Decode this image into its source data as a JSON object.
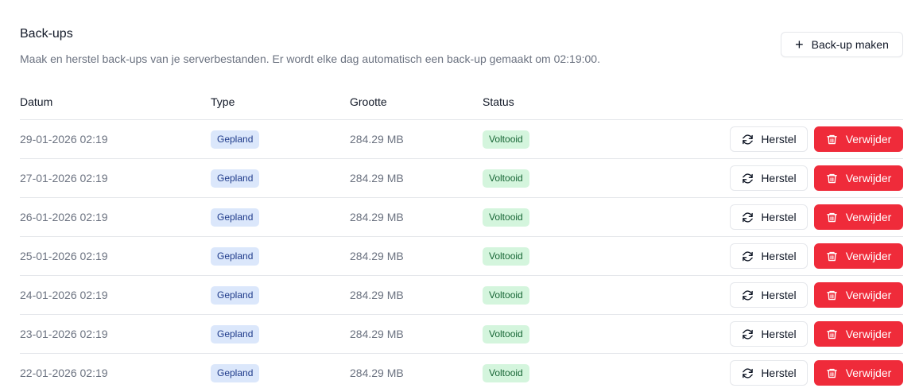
{
  "header": {
    "title": "Back-ups",
    "subtitle": "Maak en herstel back-ups van je serverbestanden. Er wordt elke dag automatisch een back-up gemaakt om 02:19:00."
  },
  "make_backup": {
    "label": "Back-up maken",
    "icon": "plus-icon"
  },
  "table": {
    "columns": [
      "Datum",
      "Type",
      "Grootte",
      "Status"
    ],
    "rows": [
      {
        "date": "29-01-2026 02:19",
        "type": "Gepland",
        "size": "284.29 MB",
        "status": "Voltooid"
      },
      {
        "date": "27-01-2026 02:19",
        "type": "Gepland",
        "size": "284.29 MB",
        "status": "Voltooid"
      },
      {
        "date": "26-01-2026 02:19",
        "type": "Gepland",
        "size": "284.29 MB",
        "status": "Voltooid"
      },
      {
        "date": "25-01-2026 02:19",
        "type": "Gepland",
        "size": "284.29 MB",
        "status": "Voltooid"
      },
      {
        "date": "24-01-2026 02:19",
        "type": "Gepland",
        "size": "284.29 MB",
        "status": "Voltooid"
      },
      {
        "date": "23-01-2026 02:19",
        "type": "Gepland",
        "size": "284.29 MB",
        "status": "Voltooid"
      },
      {
        "date": "22-01-2026 02:19",
        "type": "Gepland",
        "size": "284.29 MB",
        "status": "Voltooid"
      }
    ]
  },
  "actions": {
    "restore_label": "Herstel",
    "restore_icon": "refresh-icon",
    "delete_label": "Verwijder",
    "delete_icon": "trash-icon"
  },
  "colors": {
    "delete": "#ef2b3a",
    "type_badge_bg": "#dbe7fb",
    "type_badge_text": "#1e3a8a",
    "status_badge_bg": "#d4f5dd",
    "status_badge_text": "#166534"
  }
}
